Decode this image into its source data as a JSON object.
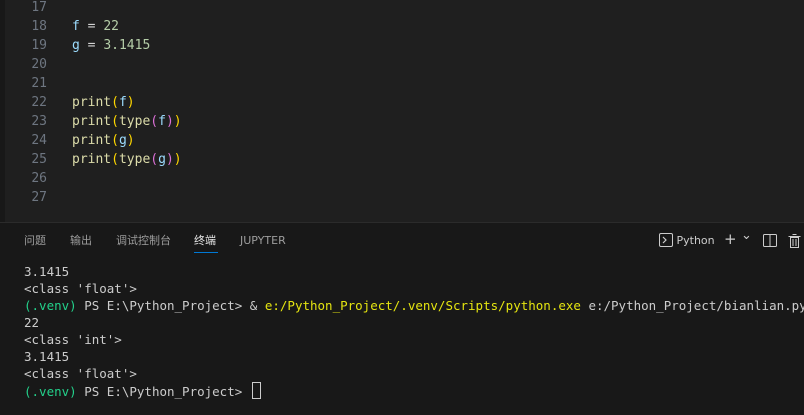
{
  "editor": {
    "lines": [
      {
        "num": "17"
      },
      {
        "num": "18",
        "tokens": [
          [
            "var",
            "f"
          ],
          [
            "op",
            " = "
          ],
          [
            "num",
            "22"
          ]
        ]
      },
      {
        "num": "19",
        "tokens": [
          [
            "var",
            "g"
          ],
          [
            "op",
            " = "
          ],
          [
            "num",
            "3.1415"
          ]
        ]
      },
      {
        "num": "20"
      },
      {
        "num": "21"
      },
      {
        "num": "22",
        "tokens": [
          [
            "fn",
            "print"
          ],
          [
            "p1",
            "("
          ],
          [
            "var",
            "f"
          ],
          [
            "p1",
            ")"
          ]
        ]
      },
      {
        "num": "23",
        "tokens": [
          [
            "fn",
            "print"
          ],
          [
            "p1",
            "("
          ],
          [
            "fn",
            "type"
          ],
          [
            "p2",
            "("
          ],
          [
            "var",
            "f"
          ],
          [
            "p2",
            ")"
          ],
          [
            "p1",
            ")"
          ]
        ]
      },
      {
        "num": "24",
        "tokens": [
          [
            "fn",
            "print"
          ],
          [
            "p1",
            "("
          ],
          [
            "var",
            "g"
          ],
          [
            "p1",
            ")"
          ]
        ]
      },
      {
        "num": "25",
        "tokens": [
          [
            "fn",
            "print"
          ],
          [
            "p1",
            "("
          ],
          [
            "fn",
            "type"
          ],
          [
            "p2",
            "("
          ],
          [
            "var",
            "g"
          ],
          [
            "p2",
            ")"
          ],
          [
            "p1",
            ")"
          ]
        ]
      },
      {
        "num": "26"
      },
      {
        "num": "27"
      }
    ]
  },
  "panel": {
    "tabs": [
      "问题",
      "输出",
      "调试控制台",
      "终端",
      "JUPYTER"
    ],
    "active_tab": "终端",
    "shell_label": "Python",
    "add_icon": "+",
    "chevron_icon": "⌄",
    "split_icon": "split-icon",
    "trash_icon": "trash-icon"
  },
  "terminal": {
    "lines": [
      {
        "text": "3.1415"
      },
      {
        "text": "<class 'float'>"
      },
      {
        "venv": "(.venv)",
        "prompt": " PS E:\\Python_Project> & ",
        "cmd": "e:/Python_Project/.venv/Scripts/python.exe",
        "rest": " e:/Python_Project/bianlian.py"
      },
      {
        "text": "22"
      },
      {
        "text": "<class 'int'>"
      },
      {
        "text": "3.1415"
      },
      {
        "text": "<class 'float'>"
      },
      {
        "venv": "(.venv)",
        "prompt": " PS E:\\Python_Project> ",
        "cursor": true
      }
    ]
  },
  "colors": {
    "venv": "#23d18b",
    "command": "#e5e510",
    "accent": "#0078d4"
  }
}
